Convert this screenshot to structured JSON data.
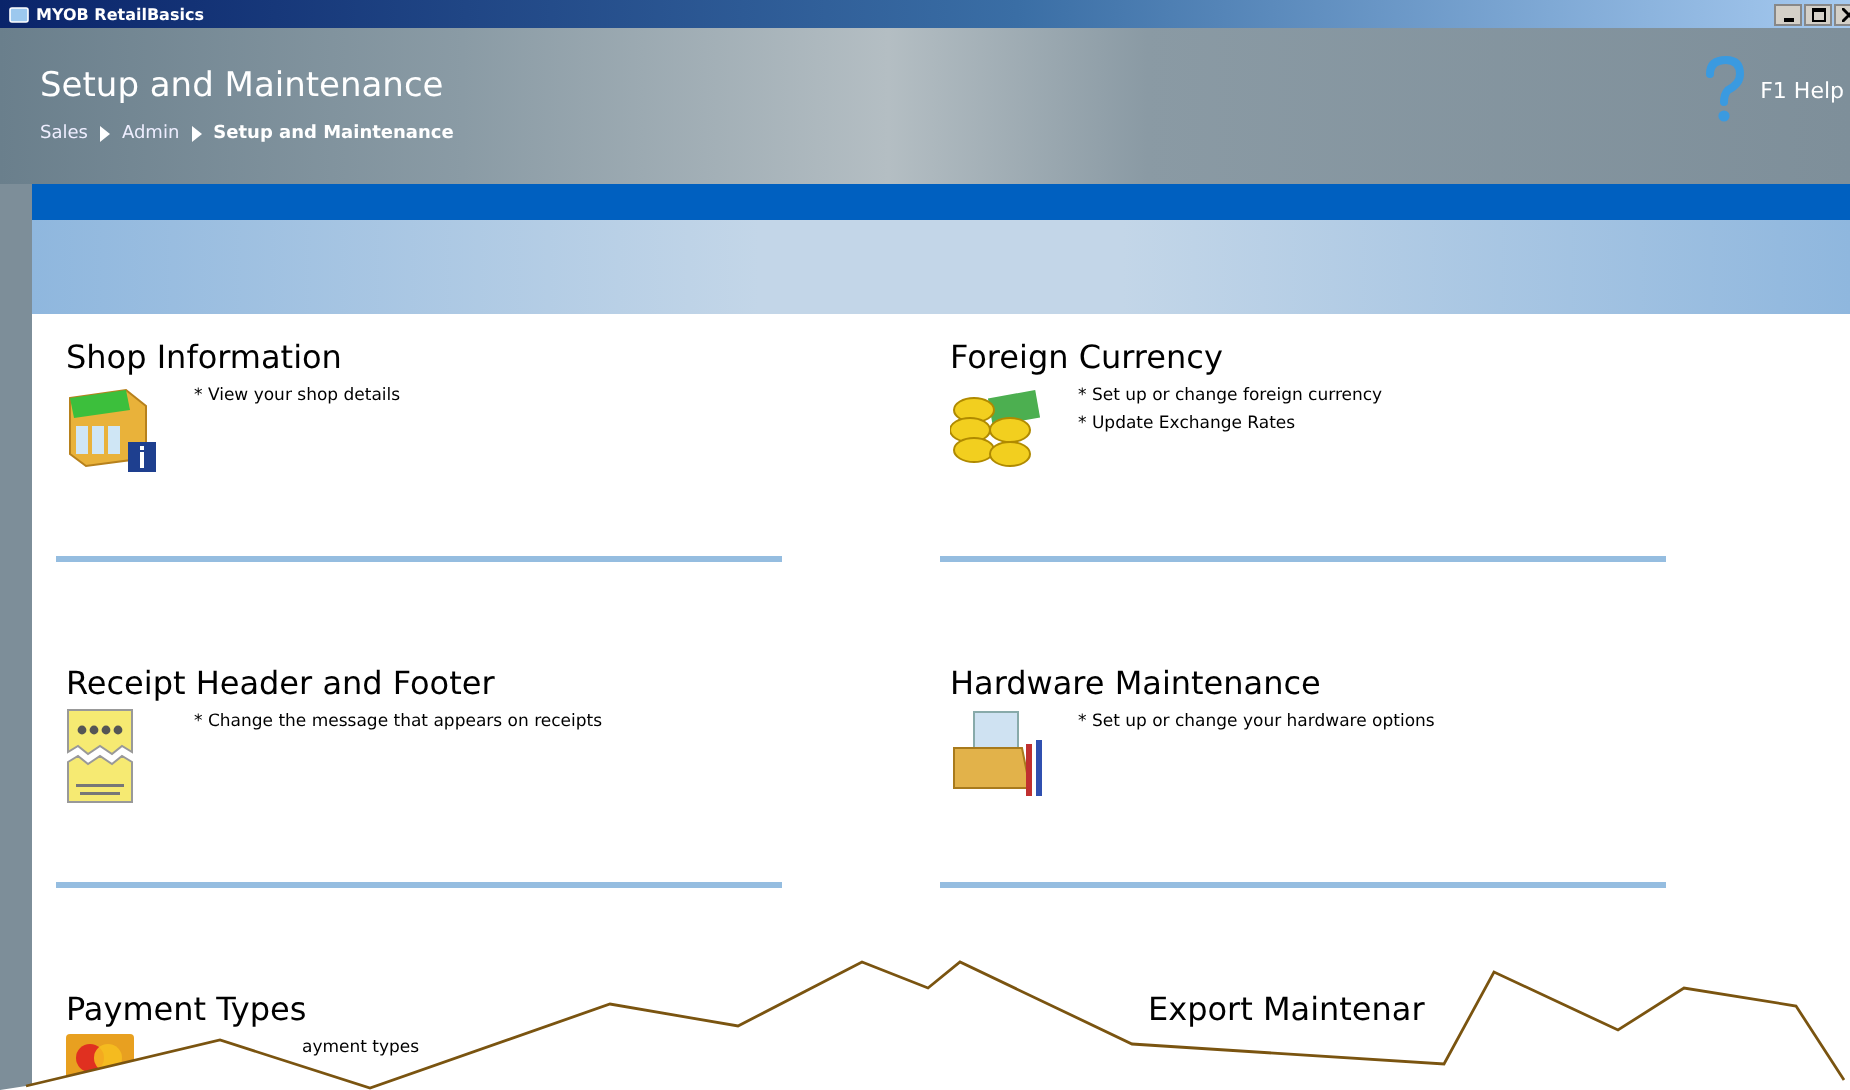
{
  "window": {
    "title": "MYOB RetailBasics"
  },
  "header": {
    "title": "Setup and Maintenance",
    "breadcrumb": [
      {
        "label": "Sales",
        "current": false
      },
      {
        "label": "Admin",
        "current": false
      },
      {
        "label": "Setup and Maintenance",
        "current": true
      }
    ],
    "help": "F1 Help"
  },
  "sections": [
    {
      "title": "Shop Information",
      "kind": "shop",
      "lines": [
        "* View your shop details"
      ]
    },
    {
      "title": "Foreign Currency",
      "kind": "coins",
      "lines": [
        "* Set up or change foreign currency",
        "* Update Exchange Rates"
      ]
    },
    {
      "title": "Receipt Header and Footer",
      "kind": "receipt",
      "lines": [
        "* Change the message that appears on receipts"
      ]
    },
    {
      "title": "Hardware Maintenance",
      "kind": "hardware",
      "lines": [
        "* Set up or change your hardware options"
      ]
    },
    {
      "title": "Payment Types",
      "kind": "card",
      "lines": [
        "ayment types"
      ]
    },
    {
      "title": "Export Maintenar",
      "kind": "none"
    }
  ]
}
